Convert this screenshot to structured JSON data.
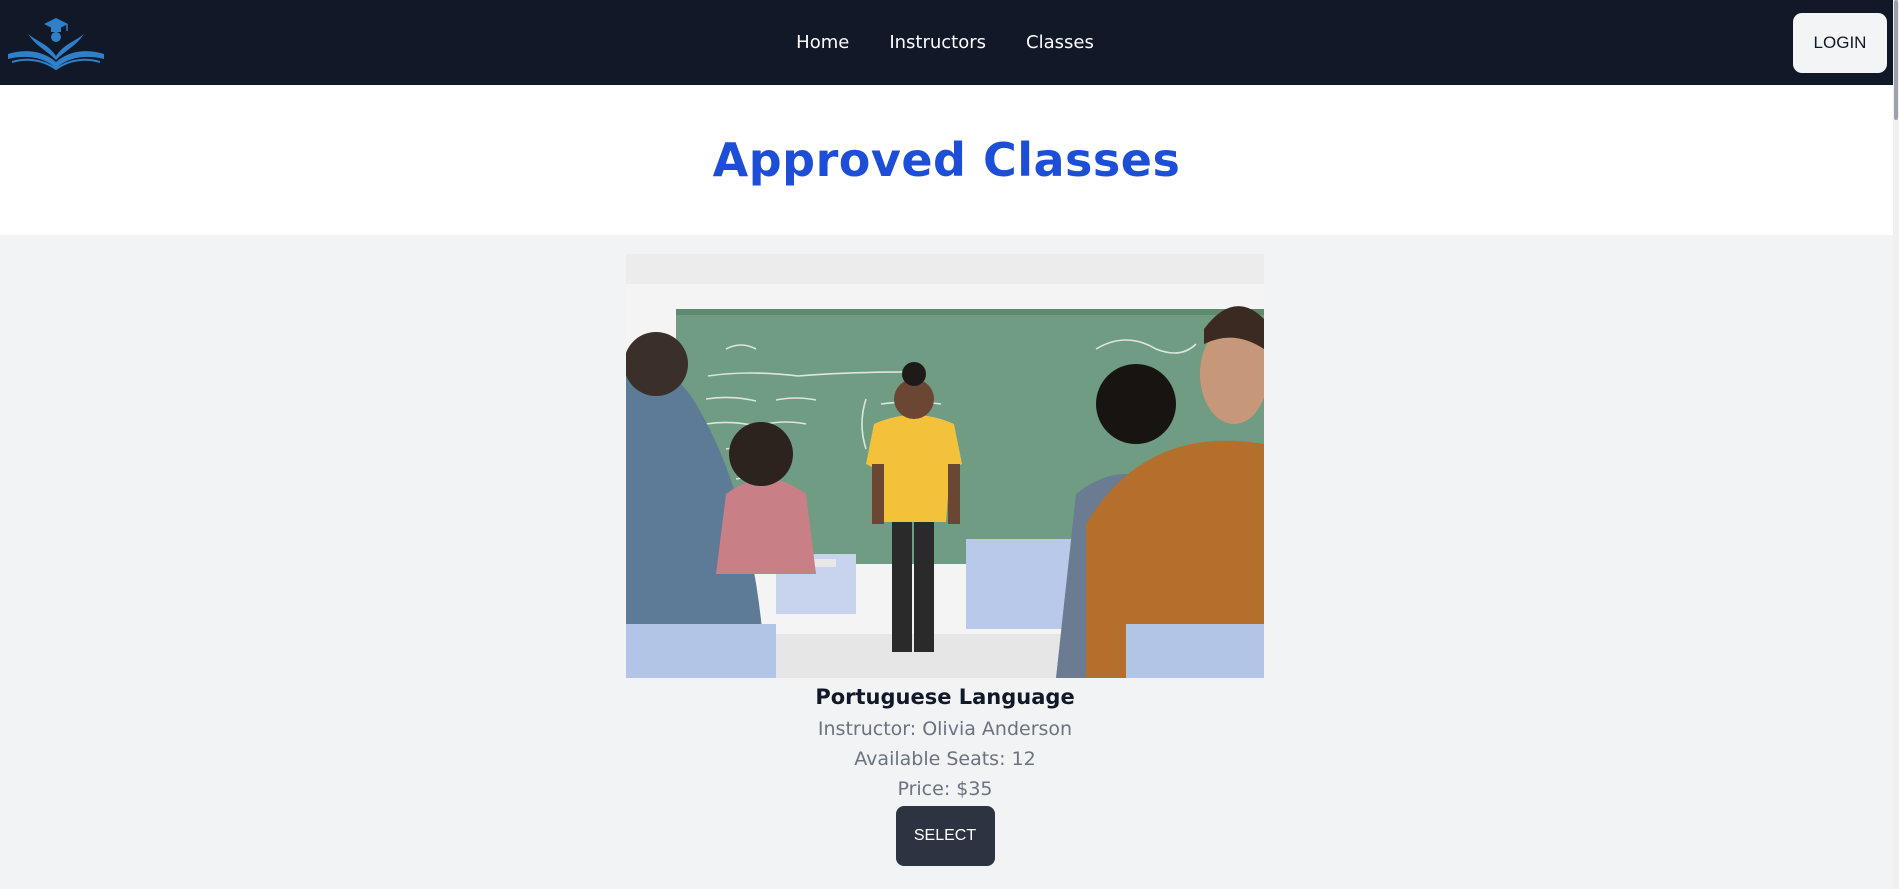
{
  "navbar": {
    "logo_alt": "Academy logo",
    "links": [
      "Home",
      "Instructors",
      "Classes"
    ],
    "login_label": "LOGIN"
  },
  "header": {
    "title": "Approved Classes"
  },
  "classes": [
    {
      "image_alt": "Teacher in yellow shirt standing in front of a green chalkboard with students",
      "name": "Portuguese Language",
      "instructor": "Instructor: Olivia Anderson",
      "seats": "Available Seats: 12",
      "price": "Price: $35",
      "button_label": "SELECT"
    }
  ],
  "colors": {
    "navbar_bg": "#111827",
    "title_blue": "#1d4ed8",
    "page_bg": "#f2f3f5",
    "button_dark": "#2b3440",
    "logo_blue": "#2f80c9"
  }
}
